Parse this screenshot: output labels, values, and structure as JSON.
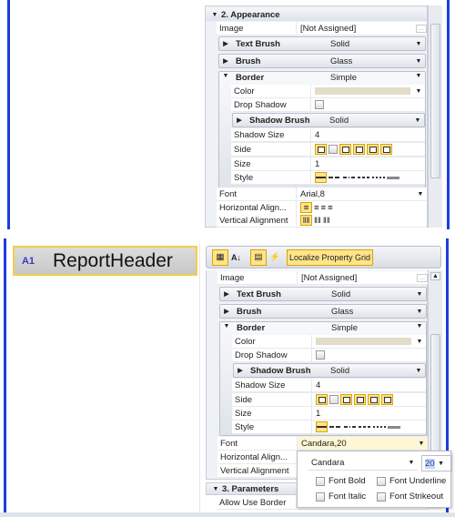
{
  "top": {
    "section": "2. Appearance",
    "image": {
      "label": "Image",
      "value": "[Not Assigned]",
      "btn": "..."
    },
    "text_brush": {
      "label": "Text Brush",
      "value": "Solid"
    },
    "brush": {
      "label": "Brush",
      "value": "Glass"
    },
    "border": {
      "label": "Border",
      "value": "Simple"
    },
    "color": {
      "label": "Color",
      "value": "#e2dcc8"
    },
    "drop_shadow": {
      "label": "Drop Shadow",
      "checked": false
    },
    "shadow_brush": {
      "label": "Shadow Brush",
      "value": "Solid"
    },
    "shadow_size": {
      "label": "Shadow Size",
      "value": "4"
    },
    "side": {
      "label": "Side"
    },
    "size": {
      "label": "Size",
      "value": "1"
    },
    "style": {
      "label": "Style"
    },
    "font": {
      "label": "Font",
      "value": "Arial,8"
    },
    "halign": {
      "label": "Horizontal Align..."
    },
    "valign": {
      "label": "Vertical Alignment"
    }
  },
  "bottom": {
    "band": {
      "title": "ReportHeader",
      "icon": "band-icon"
    },
    "toolbar": {
      "localize": "Localize Property Grid",
      "icons": [
        "categorized-icon",
        "sort-az-icon",
        "properties-icon",
        "events-icon"
      ]
    },
    "image": {
      "label": "Image",
      "value": "[Not Assigned]",
      "btn": "..."
    },
    "text_brush": {
      "label": "Text Brush",
      "value": "Solid"
    },
    "brush": {
      "label": "Brush",
      "value": "Glass"
    },
    "border": {
      "label": "Border",
      "value": "Simple"
    },
    "color": {
      "label": "Color",
      "value": "#e2dcc8"
    },
    "drop_shadow": {
      "label": "Drop Shadow",
      "checked": false
    },
    "shadow_brush": {
      "label": "Shadow Brush",
      "value": "Solid"
    },
    "shadow_size": {
      "label": "Shadow Size",
      "value": "4"
    },
    "side": {
      "label": "Side"
    },
    "size": {
      "label": "Size",
      "value": "1"
    },
    "style": {
      "label": "Style"
    },
    "font": {
      "label": "Font",
      "value": "Candara,20"
    },
    "halign": {
      "label": "Horizontal Align..."
    },
    "valign": {
      "label": "Vertical Alignment"
    },
    "section3": "3. Parameters",
    "allow_border": {
      "label": "Allow Use Border"
    },
    "font_popup": {
      "family": "Candara",
      "size": "20",
      "bold": "Font Bold",
      "underline": "Font Underline",
      "italic": "Font Italic",
      "strikeout": "Font Strikeout"
    }
  }
}
